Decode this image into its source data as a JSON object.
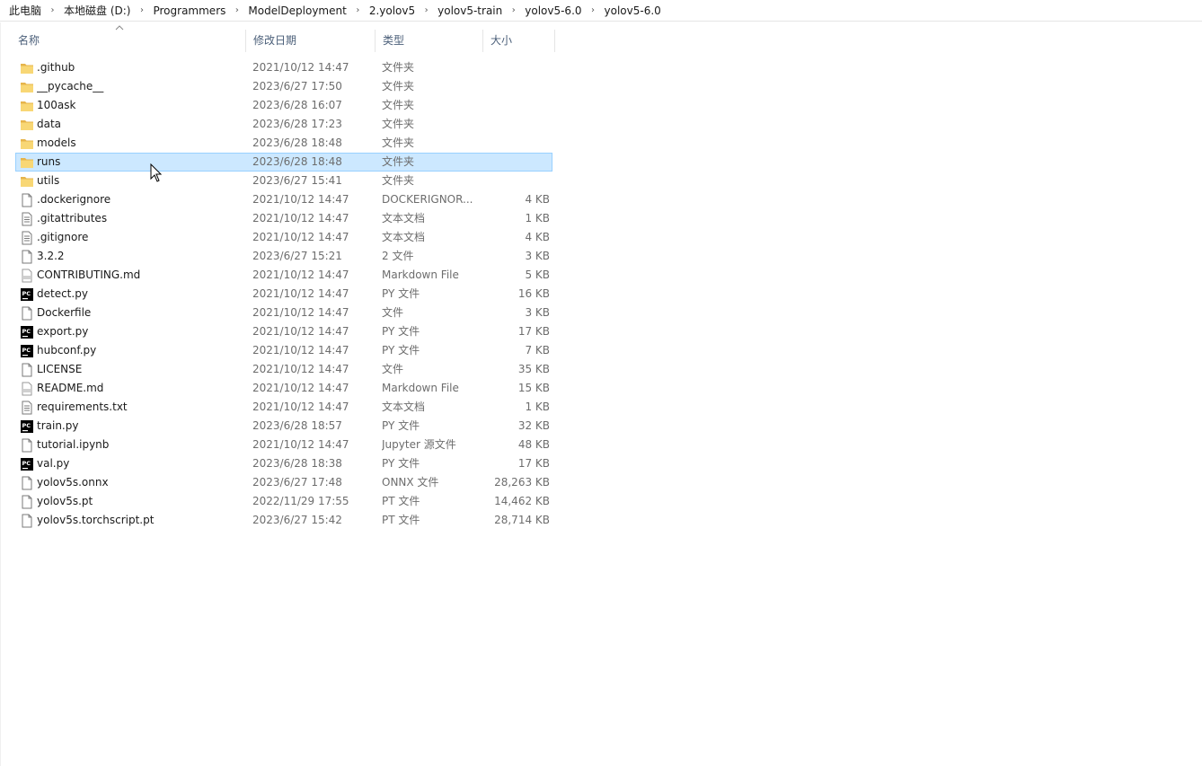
{
  "breadcrumb": [
    "此电脑",
    "本地磁盘 (D:)",
    "Programmers",
    "ModelDeployment",
    "2.yolov5",
    "yolov5-train",
    "yolov5-6.0",
    "yolov5-6.0"
  ],
  "columns": {
    "name": "名称",
    "date": "修改日期",
    "type": "类型",
    "size": "大小"
  },
  "files": [
    {
      "name": ".github",
      "date": "2021/10/12 14:47",
      "type": "文件夹",
      "size": "",
      "icon": "folder-icon"
    },
    {
      "name": "__pycache__",
      "date": "2023/6/27 17:50",
      "type": "文件夹",
      "size": "",
      "icon": "folder-icon"
    },
    {
      "name": "100ask",
      "date": "2023/6/28 16:07",
      "type": "文件夹",
      "size": "",
      "icon": "folder-icon"
    },
    {
      "name": "data",
      "date": "2023/6/28 17:23",
      "type": "文件夹",
      "size": "",
      "icon": "folder-icon"
    },
    {
      "name": "models",
      "date": "2023/6/28 18:48",
      "type": "文件夹",
      "size": "",
      "icon": "folder-icon"
    },
    {
      "name": "runs",
      "date": "2023/6/28 18:48",
      "type": "文件夹",
      "size": "",
      "icon": "folder-icon",
      "selected": true
    },
    {
      "name": "utils",
      "date": "2023/6/27 15:41",
      "type": "文件夹",
      "size": "",
      "icon": "folder-icon"
    },
    {
      "name": ".dockerignore",
      "date": "2021/10/12 14:47",
      "type": "DOCKERIGNOR...",
      "size": "4 KB",
      "icon": "file-icon"
    },
    {
      "name": ".gitattributes",
      "date": "2021/10/12 14:47",
      "type": "文本文档",
      "size": "1 KB",
      "icon": "text-file-icon"
    },
    {
      "name": ".gitignore",
      "date": "2021/10/12 14:47",
      "type": "文本文档",
      "size": "4 KB",
      "icon": "text-file-icon"
    },
    {
      "name": "3.2.2",
      "date": "2023/6/27 15:21",
      "type": "2 文件",
      "size": "3 KB",
      "icon": "file-icon"
    },
    {
      "name": "CONTRIBUTING.md",
      "date": "2021/10/12 14:47",
      "type": "Markdown File",
      "size": "5 KB",
      "icon": "markdown-file-icon"
    },
    {
      "name": "detect.py",
      "date": "2021/10/12 14:47",
      "type": "PY 文件",
      "size": "16 KB",
      "icon": "pycharm-file-icon"
    },
    {
      "name": "Dockerfile",
      "date": "2021/10/12 14:47",
      "type": "文件",
      "size": "3 KB",
      "icon": "file-icon"
    },
    {
      "name": "export.py",
      "date": "2021/10/12 14:47",
      "type": "PY 文件",
      "size": "17 KB",
      "icon": "pycharm-file-icon"
    },
    {
      "name": "hubconf.py",
      "date": "2021/10/12 14:47",
      "type": "PY 文件",
      "size": "7 KB",
      "icon": "pycharm-file-icon"
    },
    {
      "name": "LICENSE",
      "date": "2021/10/12 14:47",
      "type": "文件",
      "size": "35 KB",
      "icon": "file-icon"
    },
    {
      "name": "README.md",
      "date": "2021/10/12 14:47",
      "type": "Markdown File",
      "size": "15 KB",
      "icon": "markdown-file-icon"
    },
    {
      "name": "requirements.txt",
      "date": "2021/10/12 14:47",
      "type": "文本文档",
      "size": "1 KB",
      "icon": "text-file-icon"
    },
    {
      "name": "train.py",
      "date": "2023/6/28 18:57",
      "type": "PY 文件",
      "size": "32 KB",
      "icon": "pycharm-file-icon"
    },
    {
      "name": "tutorial.ipynb",
      "date": "2021/10/12 14:47",
      "type": "Jupyter 源文件",
      "size": "48 KB",
      "icon": "file-icon"
    },
    {
      "name": "val.py",
      "date": "2023/6/28 18:38",
      "type": "PY 文件",
      "size": "17 KB",
      "icon": "pycharm-file-icon"
    },
    {
      "name": "yolov5s.onnx",
      "date": "2023/6/27 17:48",
      "type": "ONNX 文件",
      "size": "28,263 KB",
      "icon": "file-icon"
    },
    {
      "name": "yolov5s.pt",
      "date": "2022/11/29 17:55",
      "type": "PT 文件",
      "size": "14,462 KB",
      "icon": "file-icon"
    },
    {
      "name": "yolov5s.torchscript.pt",
      "date": "2023/6/27 15:42",
      "type": "PT 文件",
      "size": "28,714 KB",
      "icon": "file-icon"
    }
  ],
  "colors": {
    "folder": "#f8d775",
    "folder_dark": "#e6b44b",
    "selection_bg": "#cce8ff",
    "selection_border": "#99d1ff",
    "header_text": "#4c607a"
  }
}
